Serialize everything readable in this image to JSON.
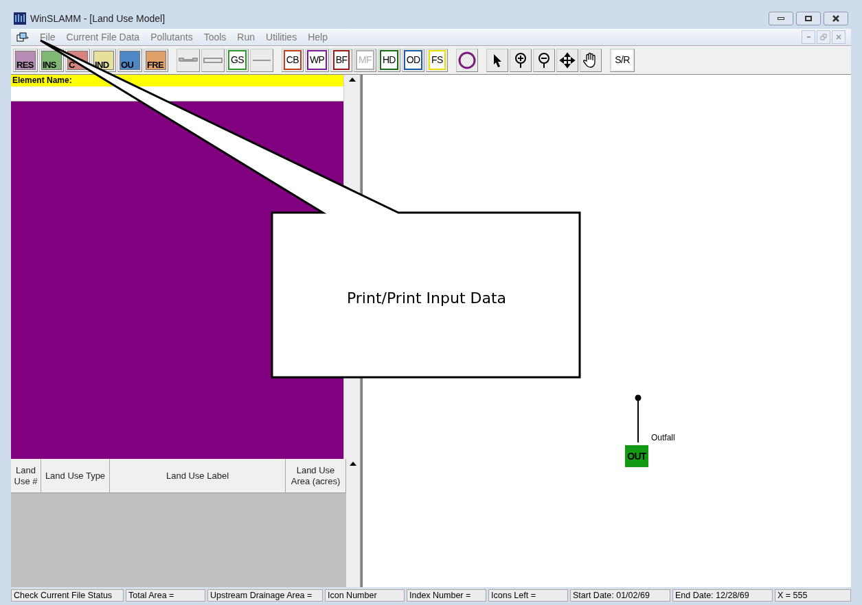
{
  "window": {
    "title": "WinSLAMM - [Land Use Model]"
  },
  "menu": [
    "File",
    "Current File Data",
    "Pollutants",
    "Tools",
    "Run",
    "Utilities",
    "Help"
  ],
  "toolbar": [
    {
      "kind": "fill",
      "label": "RES",
      "color": "#b48cb4"
    },
    {
      "kind": "fill",
      "label": "INS",
      "color": "#7fb873"
    },
    {
      "kind": "fill",
      "label": "C",
      "color": "#d9837f"
    },
    {
      "kind": "fill",
      "label": "IND",
      "color": "#e6e09a"
    },
    {
      "kind": "fill",
      "label": "OU",
      "color": "#4f86c6"
    },
    {
      "kind": "fill",
      "label": "FRE",
      "color": "#e0a06a"
    },
    {
      "kind": "gap"
    },
    {
      "kind": "channel"
    },
    {
      "kind": "pipe"
    },
    {
      "kind": "outline",
      "label": "GS",
      "color": "#2a9a2a",
      "disabled": false
    },
    {
      "kind": "flat"
    },
    {
      "kind": "gap"
    },
    {
      "kind": "outline",
      "label": "CB",
      "color": "#c43c1c",
      "disabled": false
    },
    {
      "kind": "outline",
      "label": "WP",
      "color": "#7a1a9a",
      "disabled": false
    },
    {
      "kind": "outline",
      "label": "BF",
      "color": "#9a1a1a",
      "disabled": false
    },
    {
      "kind": "outline",
      "label": "MF",
      "color": "#b0b0b0",
      "disabled": true
    },
    {
      "kind": "outline",
      "label": "HD",
      "color": "#1a6a1a",
      "disabled": false
    },
    {
      "kind": "outline",
      "label": "OD",
      "color": "#1a5aaa",
      "disabled": false
    },
    {
      "kind": "outline",
      "label": "FS",
      "color": "#e6e000",
      "disabled": false
    },
    {
      "kind": "gap"
    },
    {
      "kind": "circle",
      "color": "#7a1a7a"
    },
    {
      "kind": "gap"
    },
    {
      "kind": "pointer"
    },
    {
      "kind": "zoom-in"
    },
    {
      "kind": "zoom-out"
    },
    {
      "kind": "move"
    },
    {
      "kind": "hand"
    },
    {
      "kind": "gap"
    },
    {
      "kind": "swap",
      "label": "S/R"
    }
  ],
  "element_name": {
    "label": "Element Name:"
  },
  "table": {
    "columns": [
      "Land Use #",
      "Land Use Type",
      "Land Use Label",
      "Land Use Area (acres)"
    ]
  },
  "canvas": {
    "nodes": [
      {
        "kind": "outfall",
        "icon": "OUT",
        "label": "Outfall"
      }
    ]
  },
  "callout": {
    "text": "Print/Print Input Data"
  },
  "status_bar": [
    "Check Current File Status",
    "Total Area =",
    "Upstream Drainage Area =",
    "Icon Number",
    "Index Number =",
    "Icons Left =",
    "Start Date:  01/02/69",
    "End Date:  12/28/69",
    "X =  555"
  ]
}
